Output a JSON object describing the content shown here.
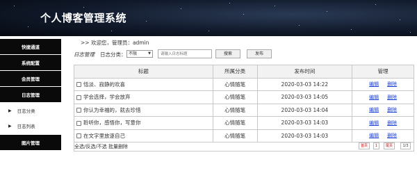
{
  "header": {
    "title": "个人博客管理系统"
  },
  "sidebar": {
    "items": [
      {
        "label": "快捷通道"
      },
      {
        "label": "系统配置"
      },
      {
        "label": "会员管理"
      },
      {
        "label": "日志管理"
      }
    ],
    "sub_items": [
      {
        "label": "日志分类"
      },
      {
        "label": "日志列表"
      }
    ],
    "last_item": {
      "label": "图片管理"
    }
  },
  "main": {
    "welcome": ">> 欢迎您，管理员：admin",
    "toolbar": {
      "title": "日志管理",
      "category_label": "日志分类：",
      "category_value": "不限",
      "search_placeholder": "请输入日志标题",
      "search_label": "搜索",
      "publish_label": "发布"
    },
    "table": {
      "headers": [
        "标题",
        "所属分类",
        "发布时间",
        "管理"
      ],
      "rows": [
        {
          "title": "恬淡、寂静的欢喜",
          "category": "心情随笔",
          "time": "2020-03-03 14:22",
          "edit": "编辑",
          "delete": "删除"
        },
        {
          "title": "学会选择，学会放弃",
          "category": "心情随笔",
          "time": "2020-03-03 14:05",
          "edit": "编辑",
          "delete": "删除"
        },
        {
          "title": "你认为幸福的，就去珍惜",
          "category": "心情随笔",
          "time": "2020-03-03 14:04",
          "edit": "编辑",
          "delete": "删除"
        },
        {
          "title": "聆听你，感悟你，写意你",
          "category": "心情随笔",
          "time": "2020-03-03 14:03",
          "edit": "编辑",
          "delete": "删除"
        },
        {
          "title": "在文字里放逐自己",
          "category": "心情随笔",
          "time": "2020-03-03 14:03",
          "edit": "编辑",
          "delete": "删除"
        }
      ]
    },
    "footer": {
      "ops": "全选/反选/不选   批量删除",
      "first": "首页",
      "page": "1",
      "last": "尾页",
      "count": "1/3"
    }
  },
  "colors": {
    "sidebar_bg": "#0a0a0a",
    "link": "#1a3fd6",
    "header_bg": "#111a2b"
  }
}
